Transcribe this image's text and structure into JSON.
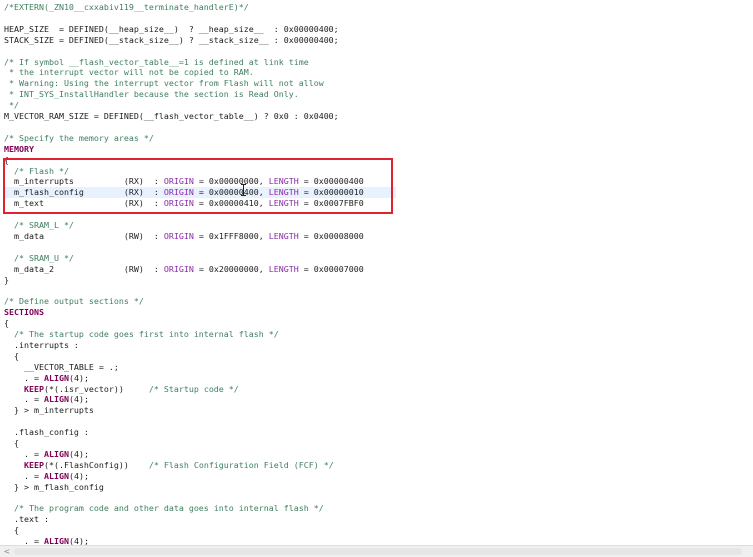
{
  "editor": {
    "lines": [
      [
        {
          "t": "/*EXTERN(_ZN10__cxxabiv119__terminate_handlerE)*/",
          "c": "comment"
        }
      ],
      [],
      [
        {
          "t": "HEAP_SIZE  = DEFINED(__heap_size__)  ? __heap_size__  : 0x00000400;",
          "c": "plain"
        }
      ],
      [
        {
          "t": "STACK_SIZE = DEFINED(__stack_size__) ? __stack_size__ : 0x00000400;",
          "c": "plain"
        }
      ],
      [],
      [
        {
          "t": "/* If symbol __flash_vector_table__=1 is defined at link time",
          "c": "comment"
        }
      ],
      [
        {
          "t": " * the interrupt vector will not be copied to RAM.",
          "c": "comment"
        }
      ],
      [
        {
          "t": " * Warning: Using the interrupt vector from Flash will not allow",
          "c": "comment"
        }
      ],
      [
        {
          "t": " * INT_SYS_InstallHandler because the section is Read Only.",
          "c": "comment"
        }
      ],
      [
        {
          "t": " */",
          "c": "comment"
        }
      ],
      [
        {
          "t": "M_VECTOR_RAM_SIZE = DEFINED(__flash_vector_table__) ? 0x0 : 0x0400;",
          "c": "plain"
        }
      ],
      [],
      [
        {
          "t": "/* Specify the memory areas */",
          "c": "comment"
        }
      ],
      [
        {
          "t": "MEMORY",
          "c": "keyword"
        }
      ],
      [
        {
          "t": "{",
          "c": "plain"
        }
      ],
      [
        {
          "t": "  /* Flash */",
          "c": "comment"
        }
      ],
      [
        {
          "t": "  m_interrupts          (RX)  : ",
          "c": "plain"
        },
        {
          "t": "ORIGIN",
          "c": "attr"
        },
        {
          "t": " = 0x00000000, ",
          "c": "plain"
        },
        {
          "t": "LENGTH",
          "c": "attr"
        },
        {
          "t": " = 0x00000400",
          "c": "plain"
        }
      ],
      [
        {
          "t": "  m_flash_config        (RX)  : ",
          "c": "plain"
        },
        {
          "t": "ORIGIN",
          "c": "attr"
        },
        {
          "t": " = 0x00000400, ",
          "c": "plain"
        },
        {
          "t": "LENGTH",
          "c": "attr"
        },
        {
          "t": " = 0x00000010",
          "c": "plain"
        }
      ],
      [
        {
          "t": "  m_text                (RX)  : ",
          "c": "plain"
        },
        {
          "t": "ORIGIN",
          "c": "attr"
        },
        {
          "t": " = 0x00000410, ",
          "c": "plain"
        },
        {
          "t": "LENGTH",
          "c": "attr"
        },
        {
          "t": " = 0x0007FBF0",
          "c": "plain"
        }
      ],
      [],
      [
        {
          "t": "  /* SRAM_L */",
          "c": "comment"
        }
      ],
      [
        {
          "t": "  m_data                (RW)  : ",
          "c": "plain"
        },
        {
          "t": "ORIGIN",
          "c": "attr"
        },
        {
          "t": " = 0x1FFF8000, ",
          "c": "plain"
        },
        {
          "t": "LENGTH",
          "c": "attr"
        },
        {
          "t": " = 0x00008000",
          "c": "plain"
        }
      ],
      [],
      [
        {
          "t": "  /* SRAM_U */",
          "c": "comment"
        }
      ],
      [
        {
          "t": "  m_data_2              (RW)  : ",
          "c": "plain"
        },
        {
          "t": "ORIGIN",
          "c": "attr"
        },
        {
          "t": " = 0x20000000, ",
          "c": "plain"
        },
        {
          "t": "LENGTH",
          "c": "attr"
        },
        {
          "t": " = 0x00007000",
          "c": "plain"
        }
      ],
      [
        {
          "t": "}",
          "c": "plain"
        }
      ],
      [],
      [
        {
          "t": "/* Define output sections */",
          "c": "comment"
        }
      ],
      [
        {
          "t": "SECTIONS",
          "c": "keyword"
        }
      ],
      [
        {
          "t": "{",
          "c": "plain"
        }
      ],
      [
        {
          "t": "  /* The startup code goes first into internal flash */",
          "c": "comment"
        }
      ],
      [
        {
          "t": "  .interrupts :",
          "c": "plain"
        }
      ],
      [
        {
          "t": "  {",
          "c": "plain"
        }
      ],
      [
        {
          "t": "    __VECTOR_TABLE = .;",
          "c": "plain"
        }
      ],
      [
        {
          "t": "    . = ",
          "c": "plain"
        },
        {
          "t": "ALIGN",
          "c": "keyword"
        },
        {
          "t": "(4);",
          "c": "plain"
        }
      ],
      [
        {
          "t": "    ",
          "c": "plain"
        },
        {
          "t": "KEEP",
          "c": "keyword"
        },
        {
          "t": "(*(.isr_vector))     ",
          "c": "plain"
        },
        {
          "t": "/* Startup code */",
          "c": "comment"
        }
      ],
      [
        {
          "t": "    . = ",
          "c": "plain"
        },
        {
          "t": "ALIGN",
          "c": "keyword"
        },
        {
          "t": "(4);",
          "c": "plain"
        }
      ],
      [
        {
          "t": "  } > m_interrupts",
          "c": "plain"
        }
      ],
      [],
      [
        {
          "t": "  .flash_config :",
          "c": "plain"
        }
      ],
      [
        {
          "t": "  {",
          "c": "plain"
        }
      ],
      [
        {
          "t": "    . = ",
          "c": "plain"
        },
        {
          "t": "ALIGN",
          "c": "keyword"
        },
        {
          "t": "(4);",
          "c": "plain"
        }
      ],
      [
        {
          "t": "    ",
          "c": "plain"
        },
        {
          "t": "KEEP",
          "c": "keyword"
        },
        {
          "t": "(*(.FlashConfig))    ",
          "c": "plain"
        },
        {
          "t": "/* Flash Configuration Field (FCF) */",
          "c": "comment"
        }
      ],
      [
        {
          "t": "    . = ",
          "c": "plain"
        },
        {
          "t": "ALIGN",
          "c": "keyword"
        },
        {
          "t": "(4);",
          "c": "plain"
        }
      ],
      [
        {
          "t": "  } > m_flash_config",
          "c": "plain"
        }
      ],
      [],
      [
        {
          "t": "  /* The program code and other data goes into internal flash */",
          "c": "comment"
        }
      ],
      [
        {
          "t": "  .text :",
          "c": "plain"
        }
      ],
      [
        {
          "t": "  {",
          "c": "plain"
        }
      ],
      [
        {
          "t": "    . = ",
          "c": "plain"
        },
        {
          "t": "ALIGN",
          "c": "keyword"
        },
        {
          "t": "(4);",
          "c": "plain"
        }
      ]
    ],
    "highlighted_line": 17,
    "boxed_lines": [
      15,
      18
    ]
  },
  "scrollbar": {
    "left_arrow": "<"
  }
}
